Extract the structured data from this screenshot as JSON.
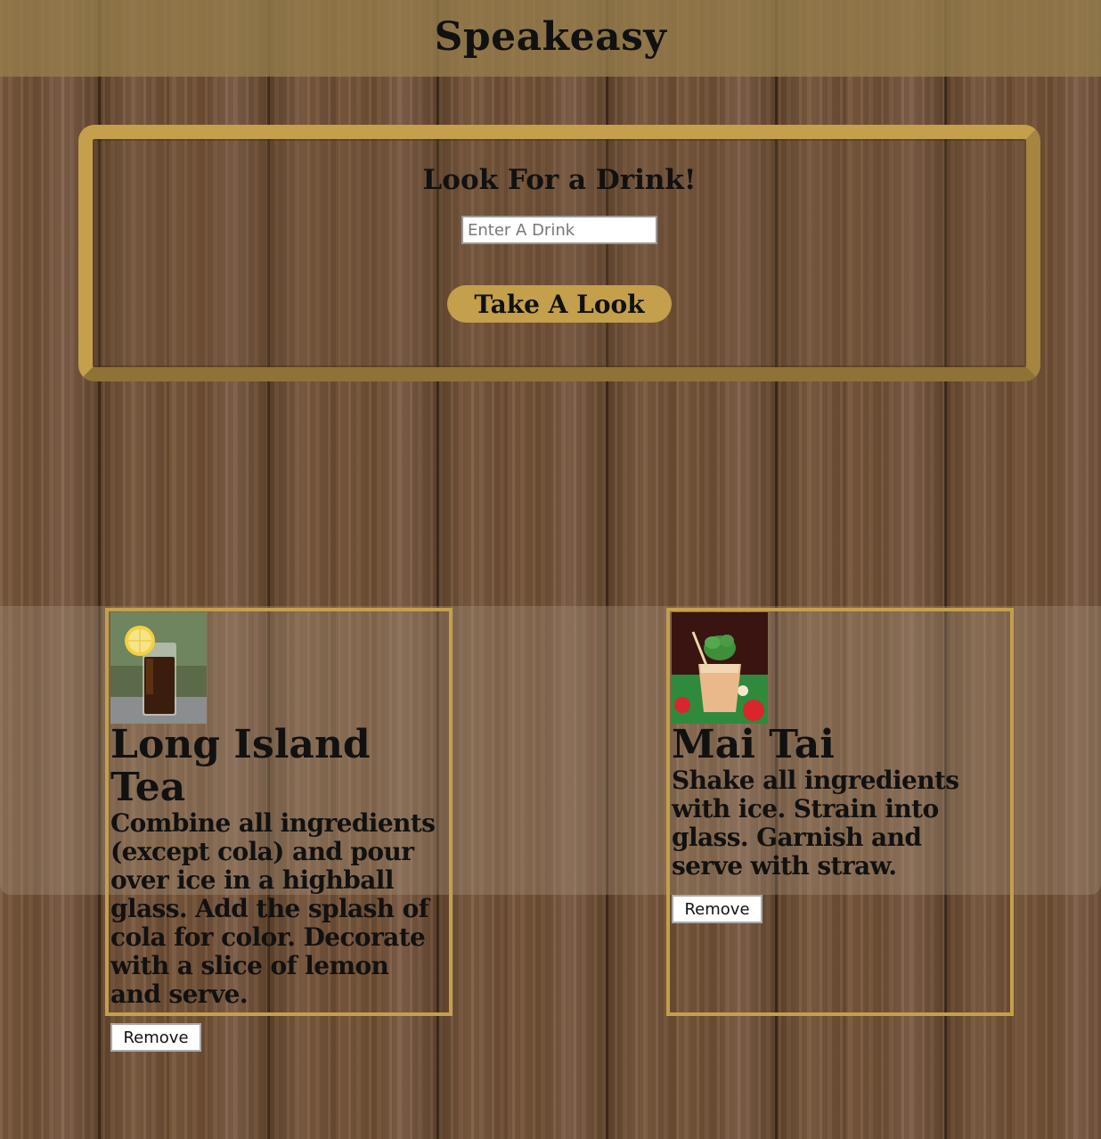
{
  "header": {
    "title": "Speakeasy"
  },
  "search": {
    "heading": "Look For a Drink!",
    "placeholder": "Enter A Drink",
    "value": "",
    "button_label": "Take A Look"
  },
  "drinks": [
    {
      "name": "Long Island Tea",
      "instructions": "Combine all ingredients (except cola) and pour over ice in a highball glass. Add the splash of cola for color. Decorate with a slice of lemon and serve.",
      "remove_label": "Remove",
      "image": "long-island-tea-photo"
    },
    {
      "name": "Mai Tai",
      "instructions": "Shake all ingredients with ice. Strain into glass. Garnish and serve with straw.",
      "remove_label": "Remove",
      "image": "mai-tai-photo"
    }
  ],
  "colors": {
    "accent_gold": "#c49f4c",
    "header_bg": "#967d4b"
  }
}
